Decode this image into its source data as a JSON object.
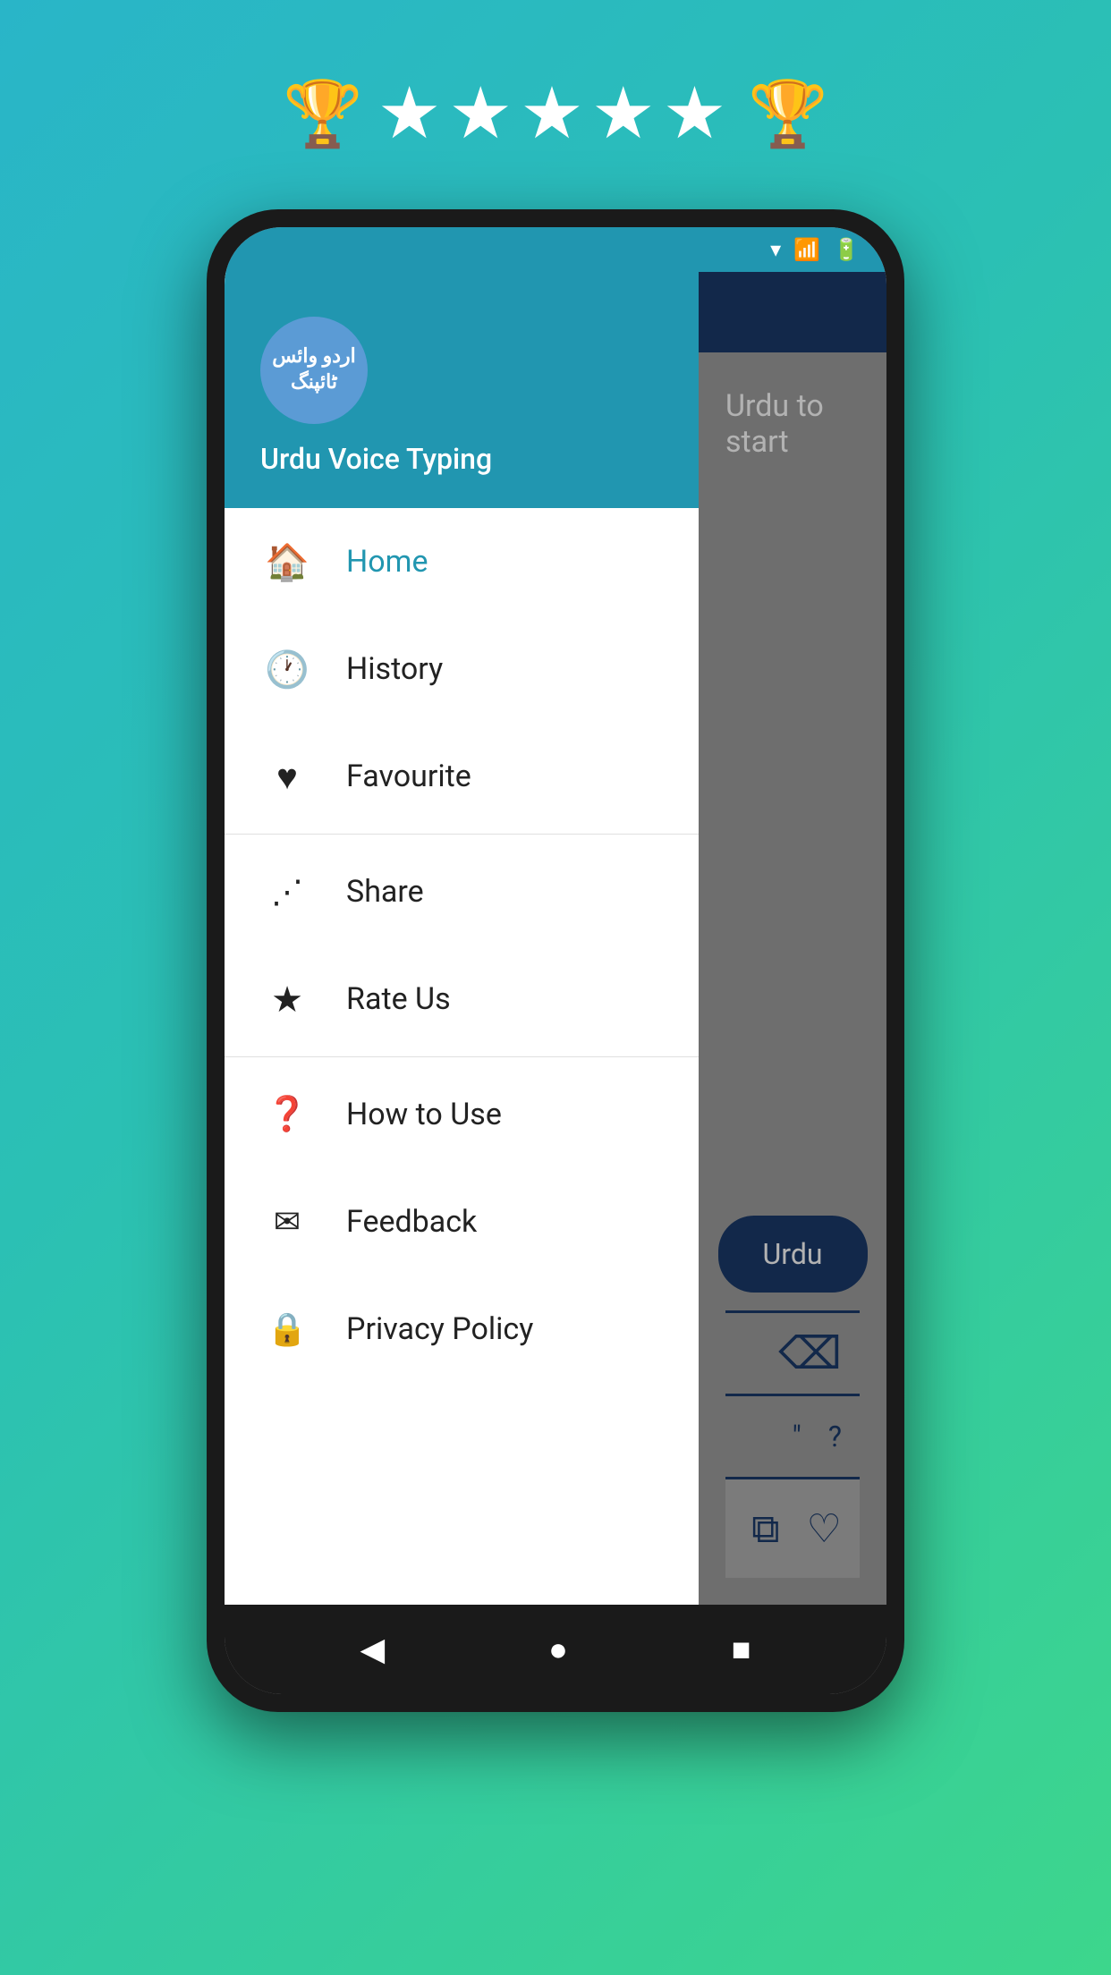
{
  "rating": {
    "stars": "★★★★★",
    "trophy": "🏆"
  },
  "app": {
    "logo_text": "اردو\nوائس\nٹائپنگ",
    "title": "Urdu Voice Typing",
    "hint": "Urdu to start"
  },
  "menu": {
    "items": [
      {
        "id": "home",
        "label": "Home",
        "icon": "🏠",
        "active": true,
        "iconType": "active-icon"
      },
      {
        "id": "history",
        "label": "History",
        "icon": "🕐",
        "active": false,
        "iconType": "dark-icon"
      },
      {
        "id": "favourite",
        "label": "Favourite",
        "icon": "♥",
        "active": false,
        "iconType": "dark-icon"
      },
      {
        "id": "share",
        "label": "Share",
        "icon": "↗",
        "active": false,
        "iconType": "dark-icon"
      },
      {
        "id": "rate-us",
        "label": "Rate Us",
        "icon": "★",
        "active": false,
        "iconType": "dark-icon"
      },
      {
        "id": "how-to-use",
        "label": "How to Use",
        "icon": "❓",
        "active": false,
        "iconType": "dark-icon"
      },
      {
        "id": "feedback",
        "label": "Feedback",
        "icon": "✉",
        "active": false,
        "iconType": "dark-icon"
      },
      {
        "id": "privacy-policy",
        "label": "Privacy Policy",
        "icon": "🔒",
        "active": false,
        "iconType": "dark-icon"
      }
    ],
    "dividers_after": [
      2,
      4
    ]
  },
  "speak_button": "Urdu",
  "nav": {
    "back": "◀",
    "home": "●",
    "recent": "■"
  }
}
